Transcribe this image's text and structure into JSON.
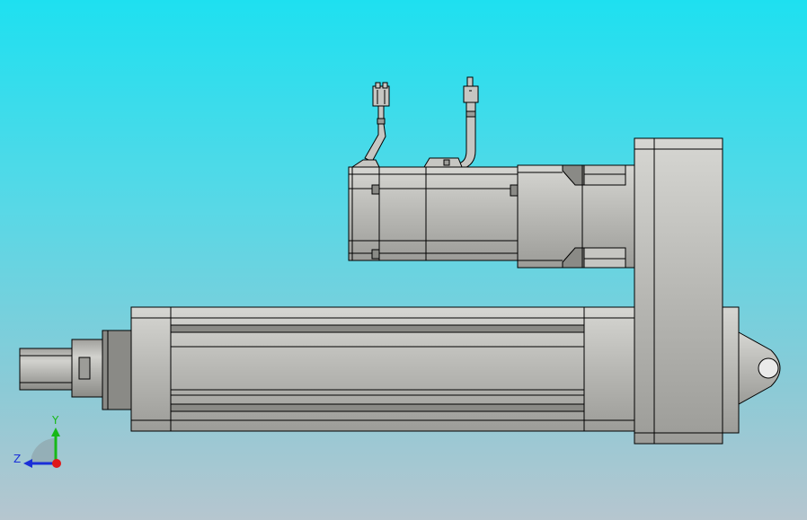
{
  "triad": {
    "y_label": "Y",
    "z_label": "Z",
    "colors": {
      "y_axis": "#17b817",
      "z_axis": "#1a2fd8",
      "x_axis": "#e01818"
    }
  },
  "model": {
    "body_color": "#b8b8b4",
    "dark_color": "#8a8a86",
    "edge_color": "#000000",
    "components": [
      "motor",
      "cable-connector-left",
      "cable-connector-right",
      "gear-housing",
      "actuator-tube",
      "rod-end",
      "rear-clevis"
    ]
  }
}
